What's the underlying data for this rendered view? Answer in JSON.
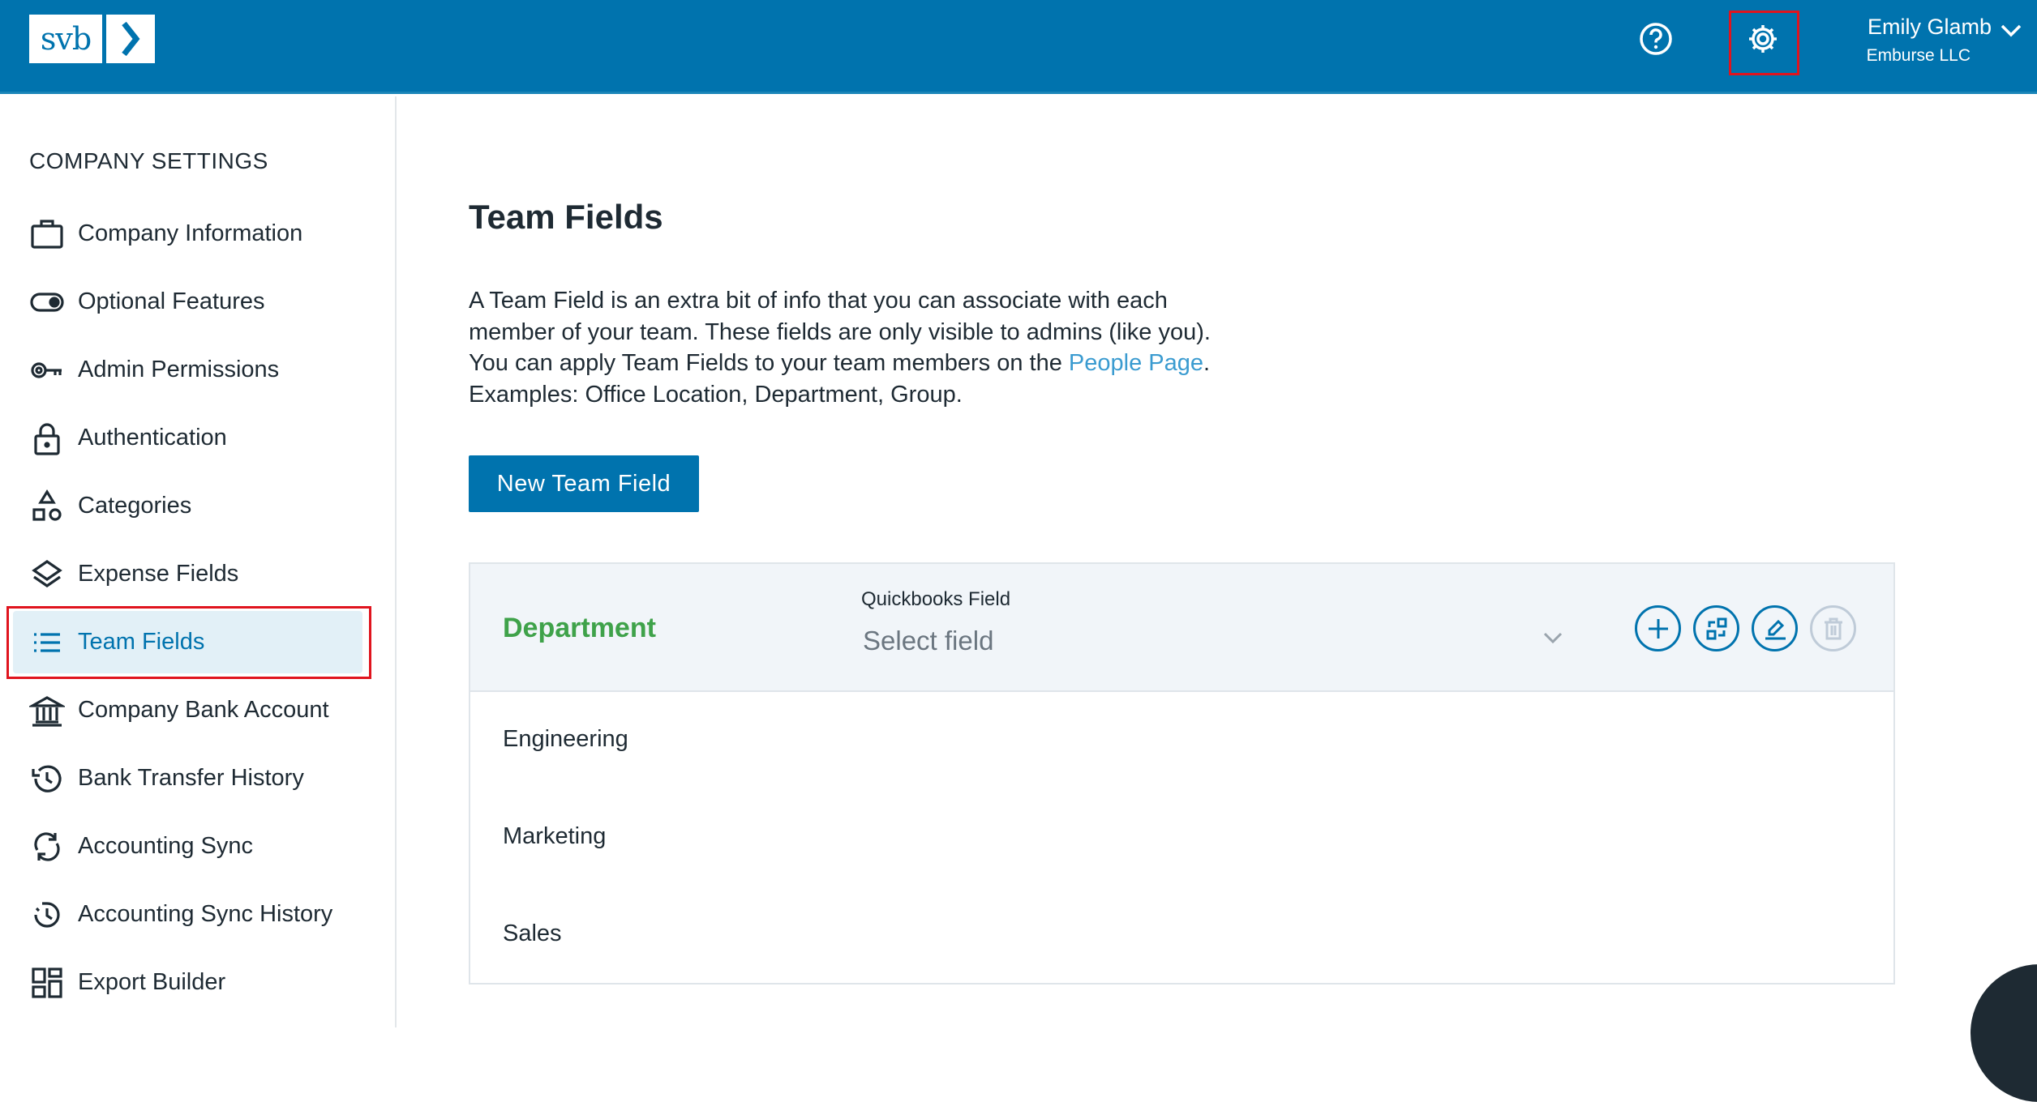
{
  "header": {
    "logo_text": "svb",
    "user_name": "Emily Glamb",
    "company": "Emburse LLC",
    "icons": [
      "help-icon",
      "gear-icon",
      "chevron-down-icon"
    ]
  },
  "sidebar": {
    "title": "COMPANY SETTINGS",
    "items": [
      {
        "label": "Company Information",
        "icon": "briefcase-icon"
      },
      {
        "label": "Optional Features",
        "icon": "toggle-icon"
      },
      {
        "label": "Admin Permissions",
        "icon": "key-icon"
      },
      {
        "label": "Authentication",
        "icon": "lock-icon"
      },
      {
        "label": "Categories",
        "icon": "shapes-icon"
      },
      {
        "label": "Expense Fields",
        "icon": "layers-icon"
      },
      {
        "label": "Team Fields",
        "icon": "list-icon",
        "active": true
      },
      {
        "label": "Company Bank Account",
        "icon": "bank-icon"
      },
      {
        "label": "Bank Transfer History",
        "icon": "history-icon"
      },
      {
        "label": "Accounting Sync",
        "icon": "sync-icon"
      },
      {
        "label": "Accounting Sync History",
        "icon": "sync-history-icon"
      },
      {
        "label": "Export Builder",
        "icon": "grid-icon"
      }
    ]
  },
  "main": {
    "title": "Team Fields",
    "desc_1": "A Team Field is an extra bit of info that you can associate with each member of your team. These fields are only visible to admins (like you). You can apply Team Fields to your team members on the ",
    "desc_link": "People Page",
    "desc_2": ".",
    "examples": "Examples: Office Location, Department, Group.",
    "new_button": "New Team Field",
    "field": {
      "name": "Department",
      "qb_label": "Quickbooks Field",
      "qb_placeholder": "Select field",
      "rows": [
        "Engineering",
        "Marketing",
        "Sales"
      ]
    }
  }
}
